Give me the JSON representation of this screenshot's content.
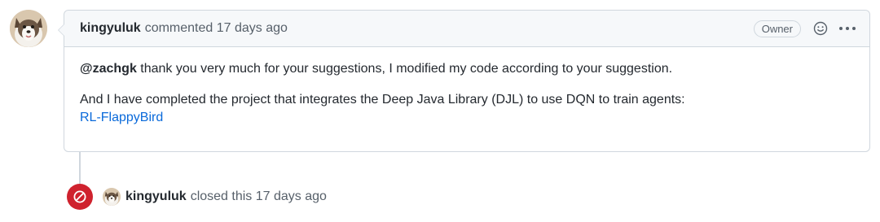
{
  "comment": {
    "author": "kingyuluk",
    "action_time": "commented 17 days ago",
    "badge": "Owner",
    "mention": "@zachgk",
    "paragraph1_rest": " thank you very much for your suggestions, I modified my code according to your suggestion.",
    "paragraph2": "And I have completed the project that integrates the Deep Java Library (DJL) to use DQN to train agents:",
    "link_text": "RL-FlappyBird",
    "icons": [
      "smiley-icon",
      "kebab-menu-icon"
    ]
  },
  "event": {
    "author": "kingyuluk",
    "text": "closed this 17 days ago",
    "icon": "circle-slash-icon"
  },
  "colors": {
    "link": "#0969da",
    "closed": "#cf222e",
    "header_bg": "#f6f8fa",
    "border": "#d0d7de"
  }
}
